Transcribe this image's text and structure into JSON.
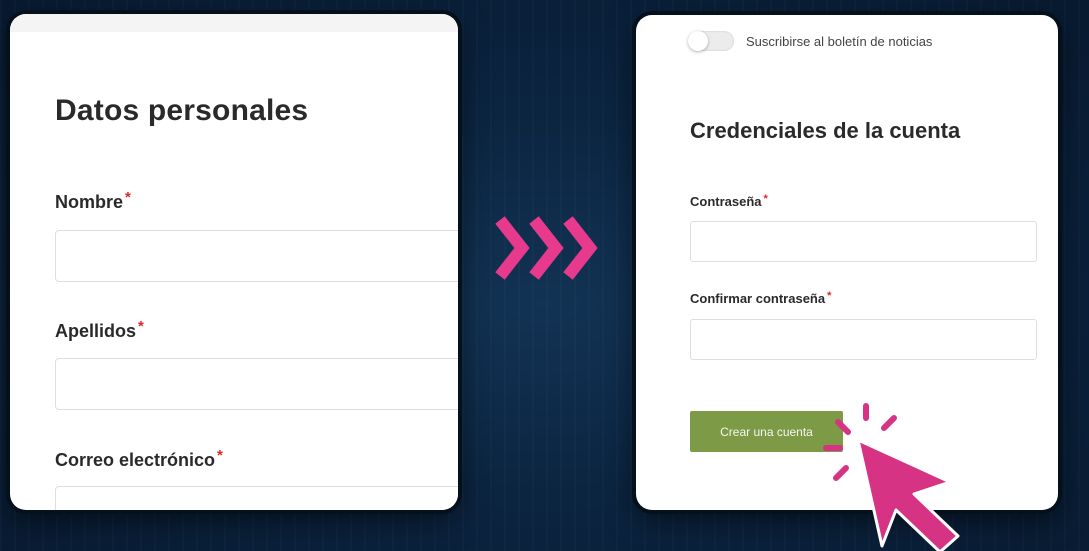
{
  "left_form": {
    "title": "Datos personales",
    "fields": [
      {
        "label": "Nombre",
        "required_mark": "*",
        "value": ""
      },
      {
        "label": "Apellidos",
        "required_mark": "*",
        "value": ""
      },
      {
        "label": "Correo electrónico",
        "required_mark": "*",
        "value": ""
      }
    ]
  },
  "right_form": {
    "newsletter_toggle_label": "Suscribirse al boletín de noticias",
    "newsletter_enabled": false,
    "title": "Credenciales de la cuenta",
    "fields": [
      {
        "label": "Contraseña",
        "required_mark": "*",
        "value": ""
      },
      {
        "label": "Confirmar contraseña",
        "required_mark": "*",
        "value": ""
      }
    ],
    "submit_label": "Crear una cuenta"
  },
  "colors": {
    "accent_magenta": "#e83a8c",
    "button_green": "#7d9a47",
    "required_red": "#e02424",
    "background_navy": "#0b2440"
  },
  "icons": {
    "transition": "triple-chevron-right-icon",
    "pointer": "cursor-click-icon"
  }
}
